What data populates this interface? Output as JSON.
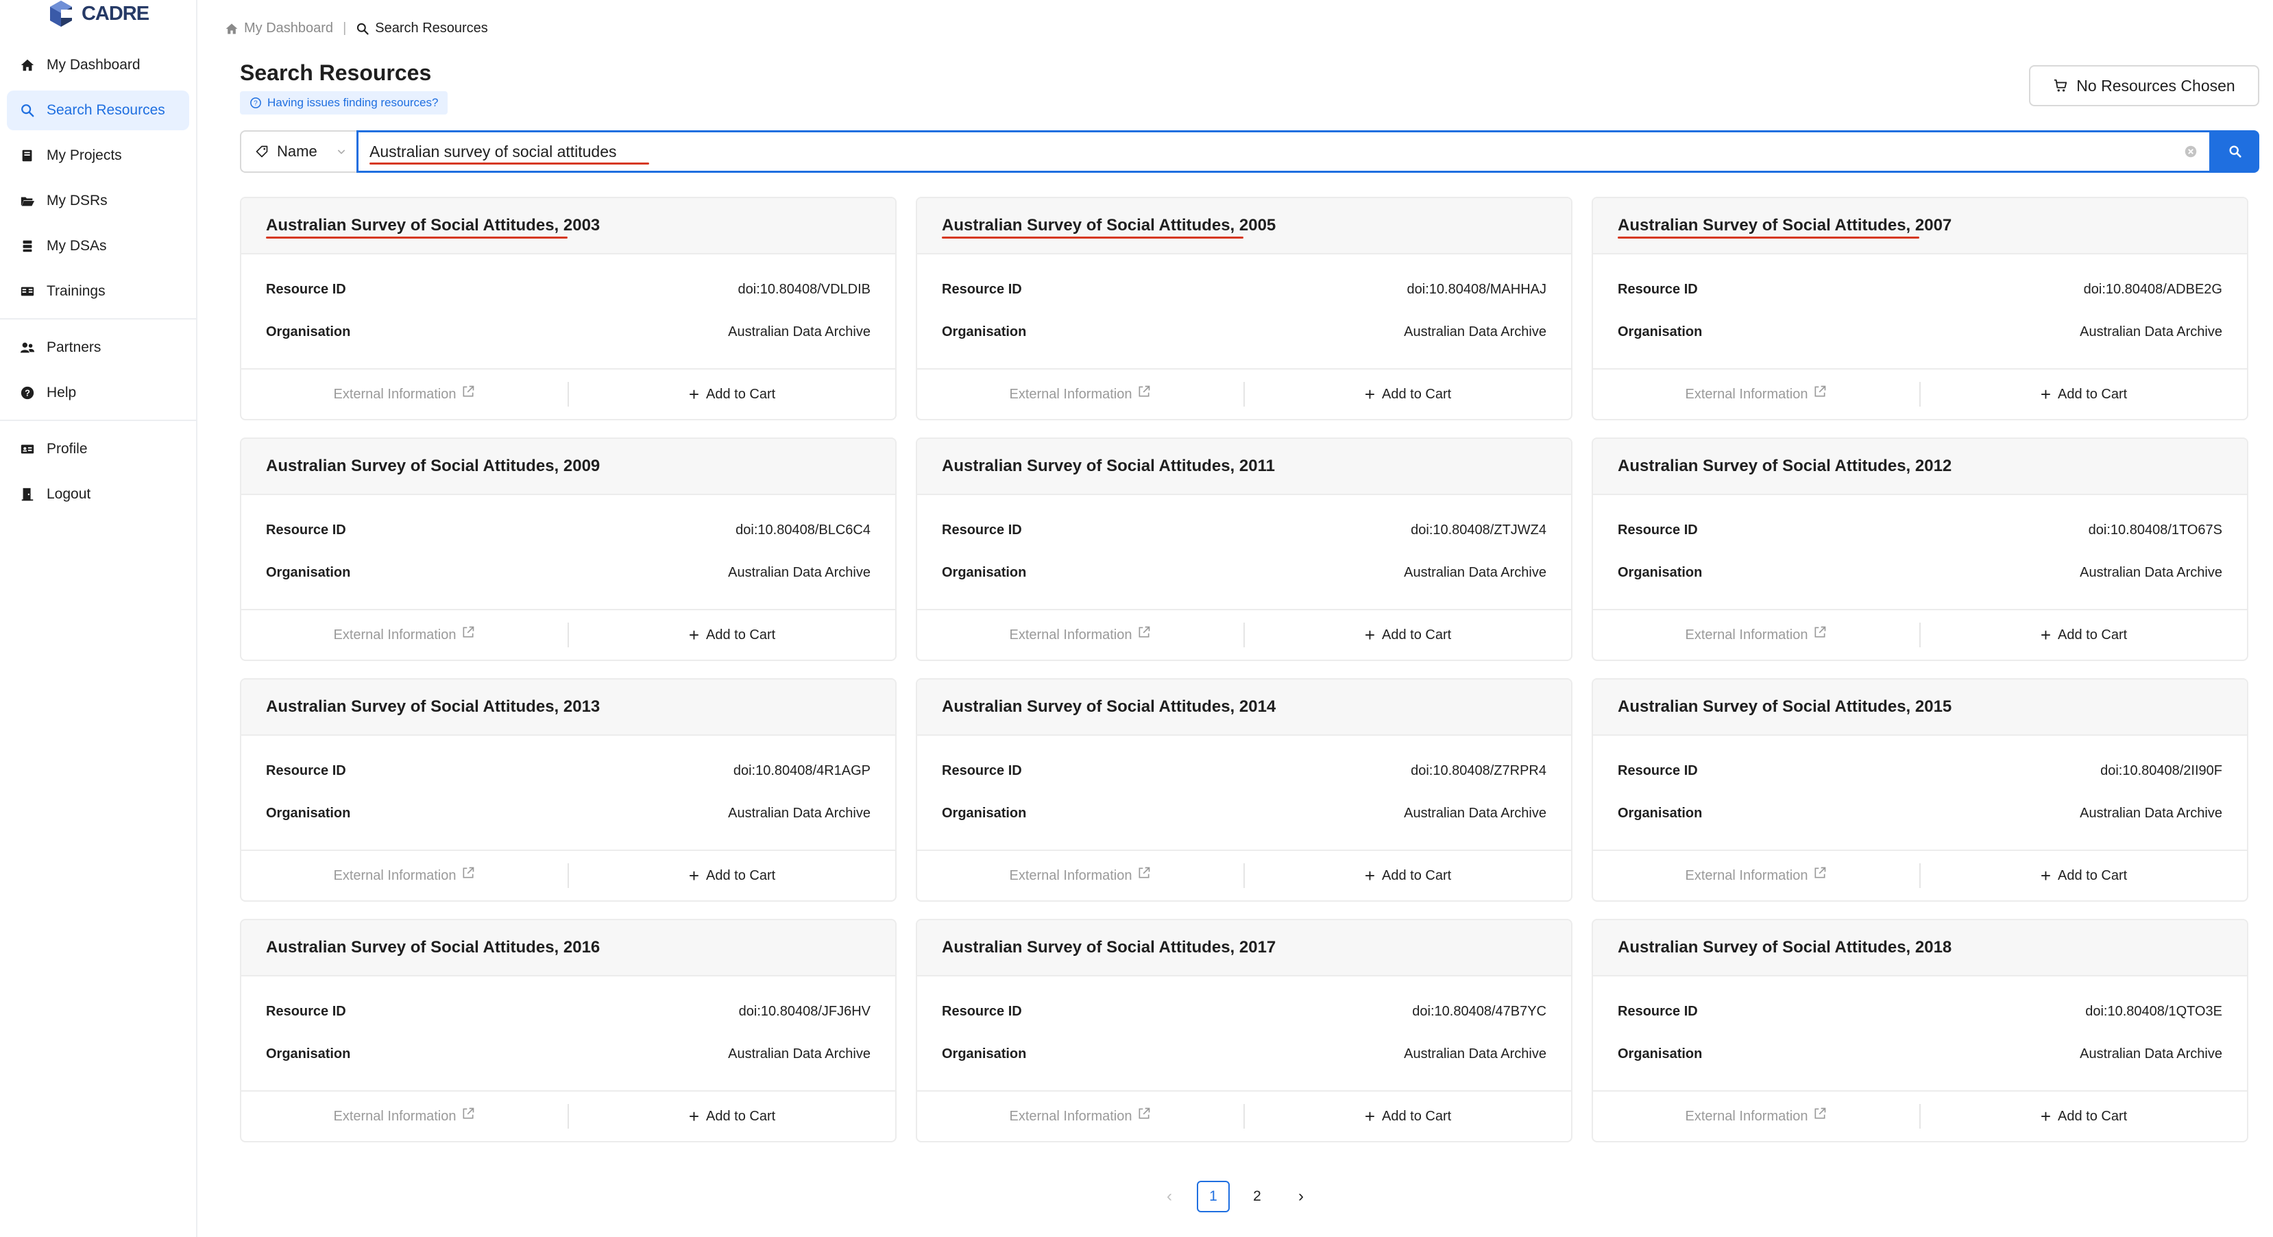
{
  "app": {
    "logo_text": "CADRE"
  },
  "sidebar": {
    "items": [
      {
        "label": "My Dashboard",
        "icon": "home-icon"
      },
      {
        "label": "Search Resources",
        "icon": "search-icon",
        "active": true
      },
      {
        "label": "My Projects",
        "icon": "book-icon"
      },
      {
        "label": "My DSRs",
        "icon": "folder-open-icon"
      },
      {
        "label": "My DSAs",
        "icon": "database-icon"
      },
      {
        "label": "Trainings",
        "icon": "read-icon"
      },
      {
        "label": "Partners",
        "icon": "team-icon"
      },
      {
        "label": "Help",
        "icon": "question-circle-icon"
      },
      {
        "label": "Profile",
        "icon": "id-card-icon"
      },
      {
        "label": "Logout",
        "icon": "logout-door-icon"
      }
    ]
  },
  "breadcrumb": {
    "home": "My Dashboard",
    "current": "Search Resources"
  },
  "page": {
    "title": "Search Resources",
    "help_link": "Having issues finding resources?",
    "cart_label": "No Resources Chosen"
  },
  "search": {
    "field": "Name",
    "query": "Australian survey of social attitudes"
  },
  "card_labels": {
    "resource_id": "Resource ID",
    "organisation": "Organisation",
    "external": "External Information",
    "add": "Add to Cart"
  },
  "results": [
    {
      "title": "Australian Survey of Social Attitudes, 2003",
      "resource_id": "doi:10.80408/VDLDIB",
      "organisation": "Australian Data Archive"
    },
    {
      "title": "Australian Survey of Social Attitudes, 2005",
      "resource_id": "doi:10.80408/MAHHAJ",
      "organisation": "Australian Data Archive"
    },
    {
      "title": "Australian Survey of Social Attitudes, 2007",
      "resource_id": "doi:10.80408/ADBE2G",
      "organisation": "Australian Data Archive"
    },
    {
      "title": "Australian Survey of Social Attitudes, 2009",
      "resource_id": "doi:10.80408/BLC6C4",
      "organisation": "Australian Data Archive"
    },
    {
      "title": "Australian Survey of Social Attitudes, 2011",
      "resource_id": "doi:10.80408/ZTJWZ4",
      "organisation": "Australian Data Archive"
    },
    {
      "title": "Australian Survey of Social Attitudes, 2012",
      "resource_id": "doi:10.80408/1TO67S",
      "organisation": "Australian Data Archive"
    },
    {
      "title": "Australian Survey of Social Attitudes, 2013",
      "resource_id": "doi:10.80408/4R1AGP",
      "organisation": "Australian Data Archive"
    },
    {
      "title": "Australian Survey of Social Attitudes, 2014",
      "resource_id": "doi:10.80408/Z7RPR4",
      "organisation": "Australian Data Archive"
    },
    {
      "title": "Australian Survey of Social Attitudes, 2015",
      "resource_id": "doi:10.80408/2II90F",
      "organisation": "Australian Data Archive"
    },
    {
      "title": "Australian Survey of Social Attitudes, 2016",
      "resource_id": "doi:10.80408/JFJ6HV",
      "organisation": "Australian Data Archive"
    },
    {
      "title": "Australian Survey of Social Attitudes, 2017",
      "resource_id": "doi:10.80408/47B7YC",
      "organisation": "Australian Data Archive"
    },
    {
      "title": "Australian Survey of Social Attitudes, 2018",
      "resource_id": "doi:10.80408/1QTO3E",
      "organisation": "Australian Data Archive"
    }
  ],
  "pagination": {
    "pages": [
      "1",
      "2"
    ],
    "current": "1"
  },
  "colors": {
    "accent": "#1f6fe0",
    "spellcheck": "#d6381f",
    "brand": "#263a66"
  }
}
